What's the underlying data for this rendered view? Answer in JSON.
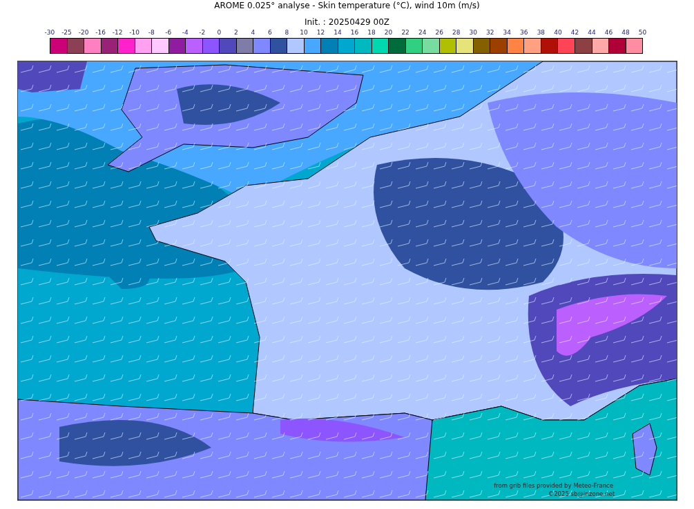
{
  "title": "AROME 0.025° analyse - Skin temperature (°C), wind 10m (m/s)",
  "init": "Init. : 20250429 00Z",
  "colorbar": {
    "ticks": [
      "-30",
      "-25",
      "-20",
      "-16",
      "-12",
      "-10",
      "-8",
      "-6",
      "-4",
      "-2",
      "0",
      "2",
      "4",
      "6",
      "8",
      "10",
      "12",
      "14",
      "16",
      "18",
      "20",
      "22",
      "24",
      "26",
      "28",
      "30",
      "32",
      "34",
      "36",
      "38",
      "40",
      "42",
      "44",
      "46",
      "48",
      "50"
    ],
    "bins": [
      {
        "color": "#cc0077"
      },
      {
        "color": "#8b4055"
      },
      {
        "color": "#ff80c0"
      },
      {
        "color": "#992277"
      },
      {
        "color": "#ff22cc"
      },
      {
        "color": "#ffa0f0"
      },
      {
        "color": "#ffc8ff"
      },
      {
        "color": "#901ca0"
      },
      {
        "color": "#bb60ff"
      },
      {
        "color": "#8c55ff"
      },
      {
        "color": "#5048bb"
      },
      {
        "color": "#807ca8"
      },
      {
        "color": "#8088ff"
      },
      {
        "color": "#3050a0"
      },
      {
        "color": "#b0c8ff"
      },
      {
        "color": "#48a8ff"
      },
      {
        "color": "#0080b4"
      },
      {
        "color": "#00a8d0"
      },
      {
        "color": "#00b8c0"
      },
      {
        "color": "#00d8b0"
      },
      {
        "color": "#006c3c"
      },
      {
        "color": "#30d080"
      },
      {
        "color": "#78dca0"
      },
      {
        "color": "#b0c000"
      },
      {
        "color": "#e6e478"
      },
      {
        "color": "#846000"
      },
      {
        "color": "#9c4000"
      },
      {
        "color": "#ff8444"
      },
      {
        "color": "#ffa080"
      },
      {
        "color": "#b01008"
      },
      {
        "color": "#ff4458"
      },
      {
        "color": "#8c4044"
      },
      {
        "color": "#ffa8a8"
      },
      {
        "color": "#b00038"
      },
      {
        "color": "#ff8ca0"
      }
    ]
  },
  "credits": [
    "from grib files provided by Meteo-France",
    "©2025 sb@irizone.net"
  ]
}
